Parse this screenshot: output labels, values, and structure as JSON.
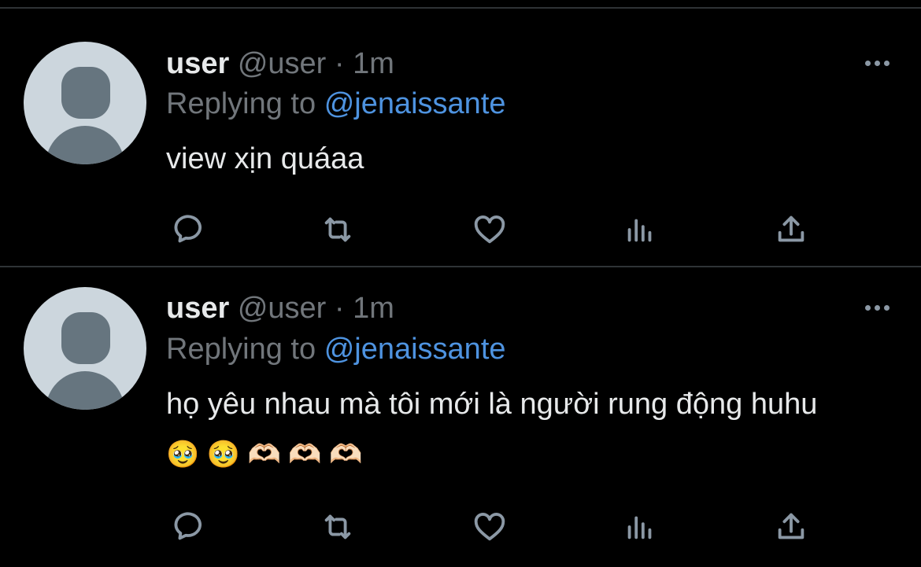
{
  "colors": {
    "background": "#000000",
    "text": "#e7e9ea",
    "secondary": "#71767b",
    "link": "#4e93e0",
    "icon": "#8b98a5",
    "divider": "#2f3336"
  },
  "tweets": [
    {
      "display_name": "user",
      "handle": "@user",
      "separator": "·",
      "time": "1m",
      "replying_label": "Replying to",
      "replying_to": "@jenaissante",
      "text": "view xịn quáaa",
      "emojis": "",
      "icons": [
        "reply-icon",
        "retweet-icon",
        "like-icon",
        "analytics-icon",
        "share-icon",
        "more-icon"
      ]
    },
    {
      "display_name": "user",
      "handle": "@user",
      "separator": "·",
      "time": "1m",
      "replying_label": "Replying to",
      "replying_to": "@jenaissante",
      "text": "họ yêu nhau mà tôi mới là người rung động huhu",
      "emojis": "🥹 🥹 🫶🏻 🫶🏻 🫶🏻",
      "icons": [
        "reply-icon",
        "retweet-icon",
        "like-icon",
        "analytics-icon",
        "share-icon",
        "more-icon"
      ]
    }
  ]
}
